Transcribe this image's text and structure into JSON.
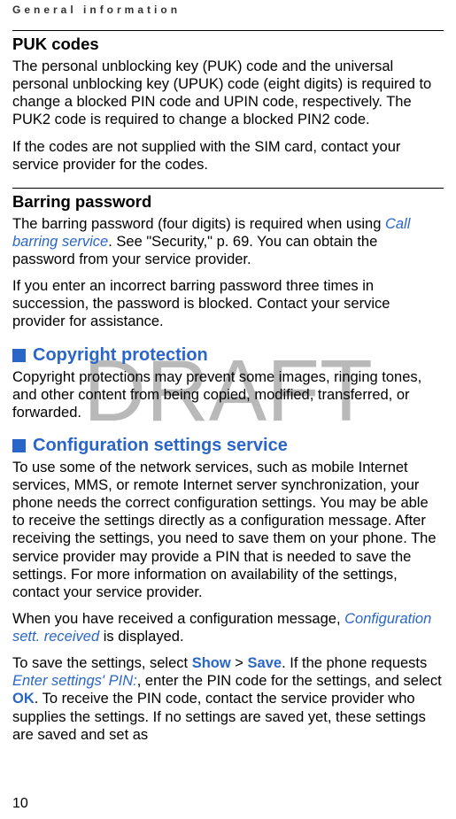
{
  "runningHeader": "General information",
  "watermark": "DRAFT",
  "pageNumber": "10",
  "sub1_title": "PUK codes",
  "sub1_p1": "The personal unblocking key (PUK) code and the universal personal unblocking key (UPUK) code (eight digits) is required to change a blocked PIN code and UPIN code, respectively. The PUK2 code is required to change a blocked PIN2 code.",
  "sub1_p2": "If the codes are not supplied with the SIM card, contact your service provider for the codes.",
  "sub2_title": "Barring password",
  "sub2_p1a": "The barring password (four digits) is required when using ",
  "sub2_p1_link": "Call barring service",
  "sub2_p1b": ". See \"Security,\" p. 69. You can obtain the password from your service provider.",
  "sub2_p2": "If you enter an incorrect barring password three times in succession, the password is blocked. Contact your service provider for assistance.",
  "sect1_title": "Copyright protection",
  "sect1_p1": "Copyright protections may prevent some images, ringing tones, and other content from being copied, modified, transferred, or forwarded.",
  "sect2_title": "Configuration settings service",
  "sect2_p1": "To use some of the network services, such as mobile Internet services, MMS, or remote Internet server synchronization, your phone needs the correct configuration settings. You may be able to receive the settings directly as a configuration message. After receiving the settings, you need to save them on your phone. The service provider may provide a PIN that is needed to save the settings. For more information on availability of the settings, contact your service provider.",
  "sect2_p2a": "When you have received a configuration message, ",
  "sect2_p2_link": "Configuration sett. received",
  "sect2_p2b": " is displayed.",
  "sect2_p3a": "To save the settings, select ",
  "sect2_p3_show": "Show",
  "sect2_p3_gt": " > ",
  "sect2_p3_save": "Save",
  "sect2_p3b": ". If the phone requests ",
  "sect2_p3_link": "Enter settings' PIN:",
  "sect2_p3c": ", enter the PIN code for the settings, and select ",
  "sect2_p3_ok": "OK",
  "sect2_p3d": ". To receive the PIN code, contact the service provider who supplies the settings. If no settings are saved yet, these settings are saved and set as"
}
